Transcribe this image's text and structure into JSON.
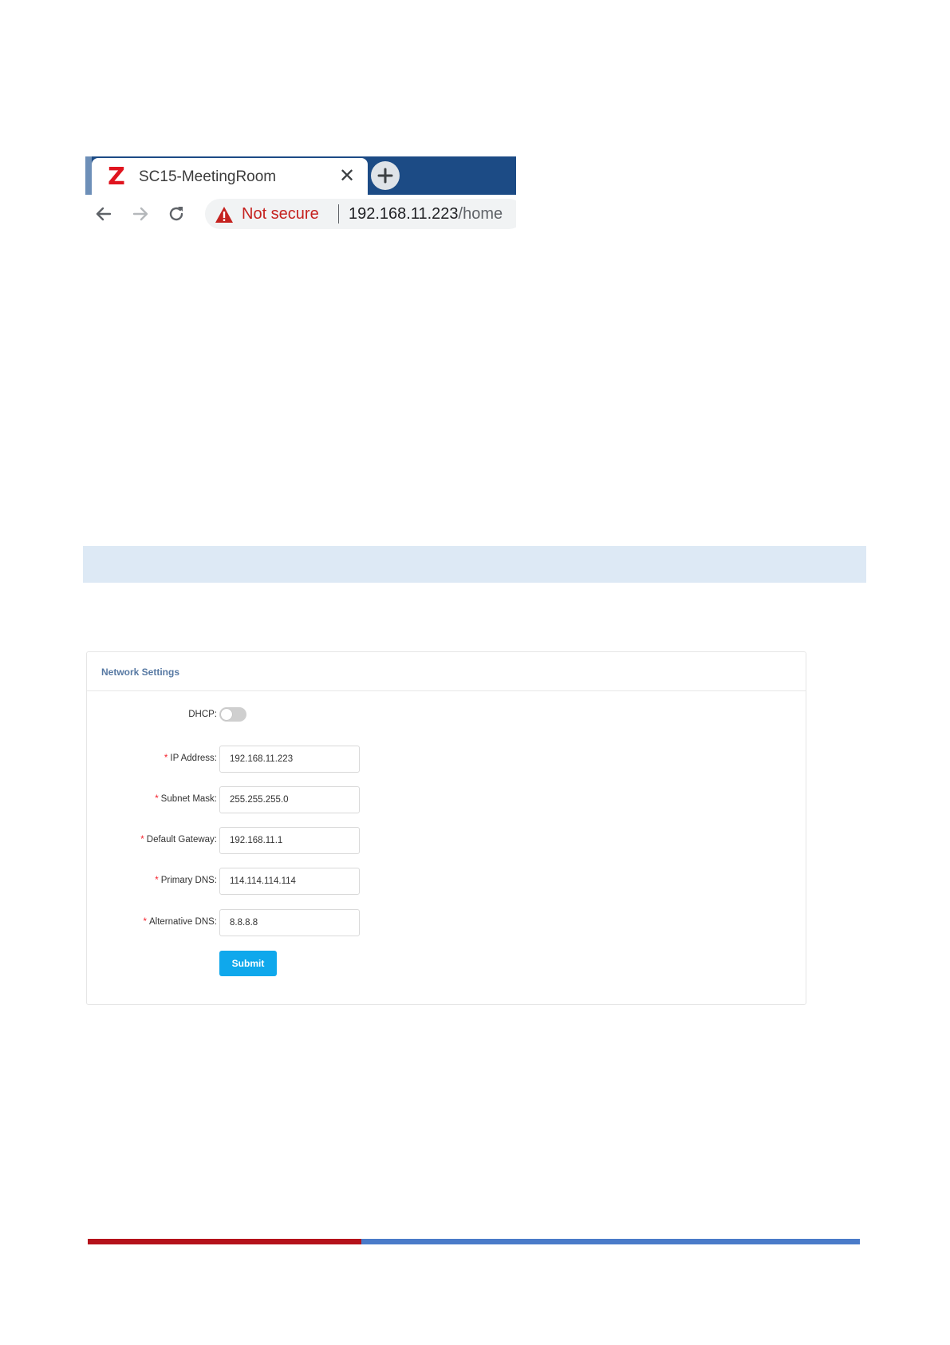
{
  "browser": {
    "tab": {
      "favicon": "Z",
      "title": "SC15-MeetingRoom",
      "close_icon": "close-icon",
      "close_glyph": "✕"
    },
    "new_tab_icon": "plus-icon",
    "nav": {
      "back_icon": "arrow-left-icon",
      "forward_icon": "arrow-right-icon",
      "reload_icon": "reload-icon"
    },
    "address_bar": {
      "warning_icon": "warning-triangle-icon",
      "security_label": "Not secure",
      "url_host": "192.168.11.223",
      "url_path": "/home"
    },
    "colors": {
      "tabstrip": "#1c4b85",
      "security_red": "#c5221f",
      "favicon_red": "#e0141e"
    }
  },
  "network_settings": {
    "title": "Network Settings",
    "dhcp": {
      "label": "DHCP:",
      "enabled": false
    },
    "fields": [
      {
        "label": "IP Address:",
        "value": "192.168.11.223",
        "required": true
      },
      {
        "label": "Subnet Mask:",
        "value": "255.255.255.0",
        "required": true
      },
      {
        "label": "Default Gateway:",
        "value": "192.168.11.1",
        "required": true
      },
      {
        "label": "Primary DNS:",
        "value": "114.114.114.114",
        "required": true
      },
      {
        "label": "Alternative DNS:",
        "value": "8.8.8.8",
        "required": true
      }
    ],
    "required_marker": "*",
    "submit_label": "Submit",
    "colors": {
      "submit": "#0fa8ec",
      "title": "#5779a3",
      "required": "#f5222d"
    }
  },
  "page_colors": {
    "info_band": "#dde9f5",
    "footer_red": "#b5121b",
    "footer_blue": "#4a7bc9"
  }
}
